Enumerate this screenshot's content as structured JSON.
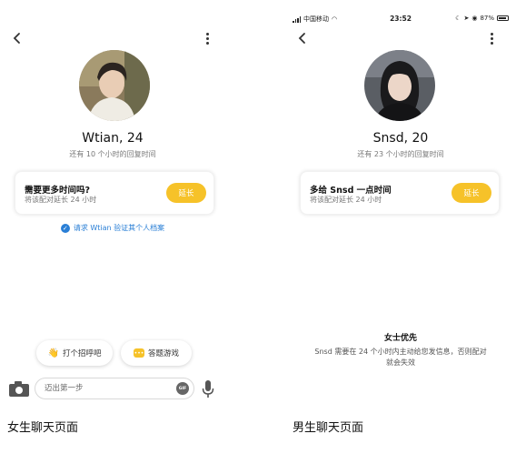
{
  "left": {
    "name_age": "Wtian, 24",
    "subtitle": "还有 10 个小时的回复时间",
    "card": {
      "title": "需要更多时间吗?",
      "desc": "将该配对延长 24 小时",
      "button": "延长"
    },
    "verify_link": "请求 Wtian 验证其个人档案",
    "chips": [
      {
        "icon": "wave-hand-icon",
        "label": "打个招呼吧"
      },
      {
        "icon": "chat-game-icon",
        "label": "答题游戏"
      }
    ],
    "input_placeholder": "迈出第一步",
    "gif_label": "GIF",
    "caption": "女生聊天页面"
  },
  "right": {
    "status_bar": {
      "carrier": "中国移动",
      "time": "23:52",
      "battery": "87%"
    },
    "name_age": "Snsd, 20",
    "subtitle": "还有 23 个小时的回复时间",
    "card": {
      "title": "多给 Snsd 一点时间",
      "desc": "将该配对延长 24 小时",
      "button": "延长"
    },
    "ladies_first": {
      "title": "女士优先",
      "desc": "Snsd 需要在 24 个小时内主动给您发信息，否则配对就会失效"
    },
    "caption": "男生聊天页面"
  },
  "colors": {
    "accent": "#f6c229",
    "link": "#2a7fd6"
  }
}
